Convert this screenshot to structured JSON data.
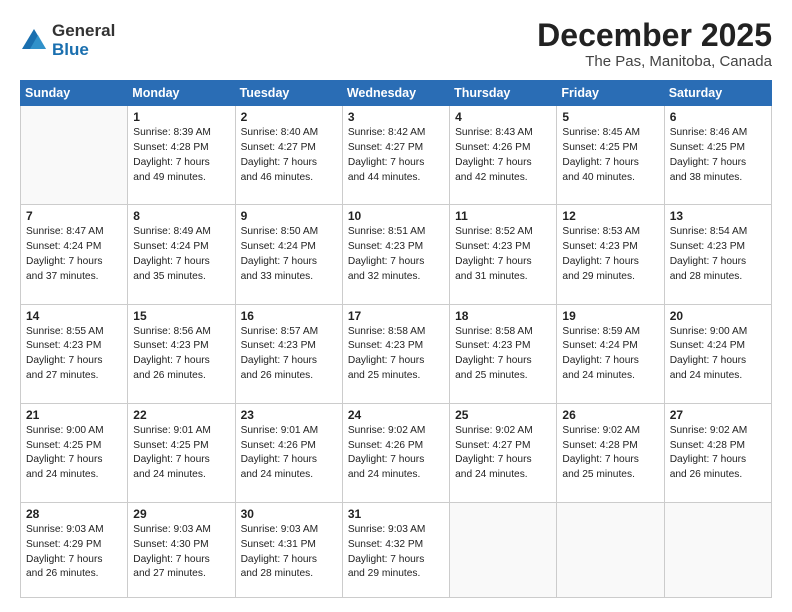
{
  "logo": {
    "general": "General",
    "blue": "Blue"
  },
  "title": "December 2025",
  "subtitle": "The Pas, Manitoba, Canada",
  "days_header": [
    "Sunday",
    "Monday",
    "Tuesday",
    "Wednesday",
    "Thursday",
    "Friday",
    "Saturday"
  ],
  "weeks": [
    [
      {
        "num": "",
        "info": ""
      },
      {
        "num": "1",
        "info": "Sunrise: 8:39 AM\nSunset: 4:28 PM\nDaylight: 7 hours\nand 49 minutes."
      },
      {
        "num": "2",
        "info": "Sunrise: 8:40 AM\nSunset: 4:27 PM\nDaylight: 7 hours\nand 46 minutes."
      },
      {
        "num": "3",
        "info": "Sunrise: 8:42 AM\nSunset: 4:27 PM\nDaylight: 7 hours\nand 44 minutes."
      },
      {
        "num": "4",
        "info": "Sunrise: 8:43 AM\nSunset: 4:26 PM\nDaylight: 7 hours\nand 42 minutes."
      },
      {
        "num": "5",
        "info": "Sunrise: 8:45 AM\nSunset: 4:25 PM\nDaylight: 7 hours\nand 40 minutes."
      },
      {
        "num": "6",
        "info": "Sunrise: 8:46 AM\nSunset: 4:25 PM\nDaylight: 7 hours\nand 38 minutes."
      }
    ],
    [
      {
        "num": "7",
        "info": "Sunrise: 8:47 AM\nSunset: 4:24 PM\nDaylight: 7 hours\nand 37 minutes."
      },
      {
        "num": "8",
        "info": "Sunrise: 8:49 AM\nSunset: 4:24 PM\nDaylight: 7 hours\nand 35 minutes."
      },
      {
        "num": "9",
        "info": "Sunrise: 8:50 AM\nSunset: 4:24 PM\nDaylight: 7 hours\nand 33 minutes."
      },
      {
        "num": "10",
        "info": "Sunrise: 8:51 AM\nSunset: 4:23 PM\nDaylight: 7 hours\nand 32 minutes."
      },
      {
        "num": "11",
        "info": "Sunrise: 8:52 AM\nSunset: 4:23 PM\nDaylight: 7 hours\nand 31 minutes."
      },
      {
        "num": "12",
        "info": "Sunrise: 8:53 AM\nSunset: 4:23 PM\nDaylight: 7 hours\nand 29 minutes."
      },
      {
        "num": "13",
        "info": "Sunrise: 8:54 AM\nSunset: 4:23 PM\nDaylight: 7 hours\nand 28 minutes."
      }
    ],
    [
      {
        "num": "14",
        "info": "Sunrise: 8:55 AM\nSunset: 4:23 PM\nDaylight: 7 hours\nand 27 minutes."
      },
      {
        "num": "15",
        "info": "Sunrise: 8:56 AM\nSunset: 4:23 PM\nDaylight: 7 hours\nand 26 minutes."
      },
      {
        "num": "16",
        "info": "Sunrise: 8:57 AM\nSunset: 4:23 PM\nDaylight: 7 hours\nand 26 minutes."
      },
      {
        "num": "17",
        "info": "Sunrise: 8:58 AM\nSunset: 4:23 PM\nDaylight: 7 hours\nand 25 minutes."
      },
      {
        "num": "18",
        "info": "Sunrise: 8:58 AM\nSunset: 4:23 PM\nDaylight: 7 hours\nand 25 minutes."
      },
      {
        "num": "19",
        "info": "Sunrise: 8:59 AM\nSunset: 4:24 PM\nDaylight: 7 hours\nand 24 minutes."
      },
      {
        "num": "20",
        "info": "Sunrise: 9:00 AM\nSunset: 4:24 PM\nDaylight: 7 hours\nand 24 minutes."
      }
    ],
    [
      {
        "num": "21",
        "info": "Sunrise: 9:00 AM\nSunset: 4:25 PM\nDaylight: 7 hours\nand 24 minutes."
      },
      {
        "num": "22",
        "info": "Sunrise: 9:01 AM\nSunset: 4:25 PM\nDaylight: 7 hours\nand 24 minutes."
      },
      {
        "num": "23",
        "info": "Sunrise: 9:01 AM\nSunset: 4:26 PM\nDaylight: 7 hours\nand 24 minutes."
      },
      {
        "num": "24",
        "info": "Sunrise: 9:02 AM\nSunset: 4:26 PM\nDaylight: 7 hours\nand 24 minutes."
      },
      {
        "num": "25",
        "info": "Sunrise: 9:02 AM\nSunset: 4:27 PM\nDaylight: 7 hours\nand 24 minutes."
      },
      {
        "num": "26",
        "info": "Sunrise: 9:02 AM\nSunset: 4:28 PM\nDaylight: 7 hours\nand 25 minutes."
      },
      {
        "num": "27",
        "info": "Sunrise: 9:02 AM\nSunset: 4:28 PM\nDaylight: 7 hours\nand 26 minutes."
      }
    ],
    [
      {
        "num": "28",
        "info": "Sunrise: 9:03 AM\nSunset: 4:29 PM\nDaylight: 7 hours\nand 26 minutes."
      },
      {
        "num": "29",
        "info": "Sunrise: 9:03 AM\nSunset: 4:30 PM\nDaylight: 7 hours\nand 27 minutes."
      },
      {
        "num": "30",
        "info": "Sunrise: 9:03 AM\nSunset: 4:31 PM\nDaylight: 7 hours\nand 28 minutes."
      },
      {
        "num": "31",
        "info": "Sunrise: 9:03 AM\nSunset: 4:32 PM\nDaylight: 7 hours\nand 29 minutes."
      },
      {
        "num": "",
        "info": ""
      },
      {
        "num": "",
        "info": ""
      },
      {
        "num": "",
        "info": ""
      }
    ]
  ]
}
